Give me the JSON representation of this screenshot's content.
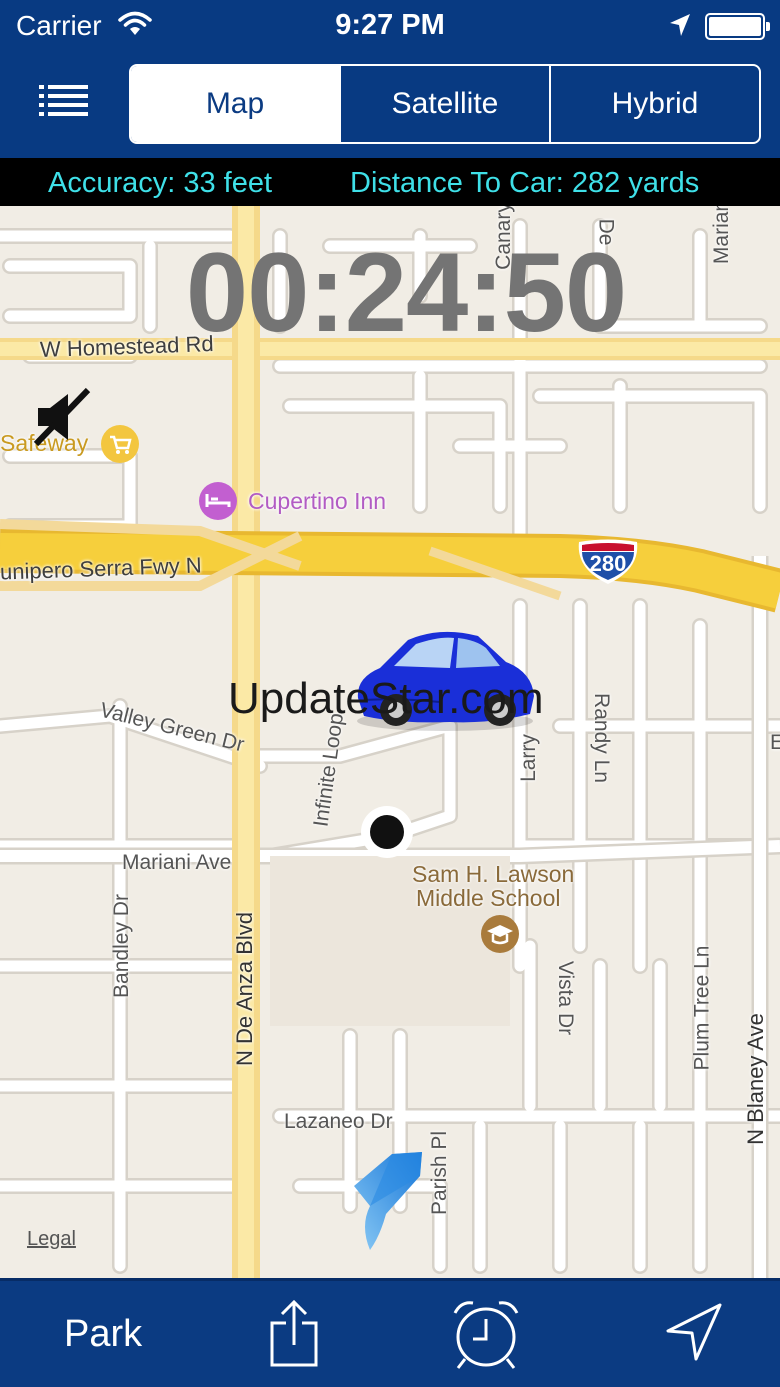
{
  "status_bar": {
    "carrier": "Carrier",
    "time": "9:27 PM"
  },
  "nav": {
    "segments": [
      "Map",
      "Satellite",
      "Hybrid"
    ],
    "selected_segment": "Map"
  },
  "info": {
    "accuracy": "Accuracy: 33 feet",
    "distance": "Distance To Car: 282 yards"
  },
  "map": {
    "timer": "00:24:50",
    "watermark": "UpdateStar.com",
    "streets": {
      "homestead": "W Homestead Rd",
      "freeway": "unipero Serra Fwy N",
      "valley_green": "Valley Green Dr",
      "mariani": "Mariani Ave",
      "bandley": "Bandley Dr",
      "de_anza": "N De Anza Blvd",
      "infinite_loop": "Infinite Loop",
      "larry": "Larry",
      "randy": "Randy Ln",
      "vista": "Vista Dr",
      "plum_tree": "Plum Tree Ln",
      "blaney": "N Blaney Ave",
      "lazaneo": "Lazaneo Dr",
      "parish": "Parish Pl",
      "canary": "Canary",
      "mariani_top": "Marian",
      "de_top": "De",
      "e_edge": "E"
    },
    "pois": {
      "safeway": "Safeway",
      "cupertino_inn": "Cupertino Inn",
      "school_line1": "Sam H. Lawson",
      "school_line2": "Middle School"
    },
    "highway_shield": "280",
    "legal": "Legal"
  },
  "tab_bar": {
    "park": "Park"
  },
  "colors": {
    "bar_blue": "#0b3b82",
    "info_text": "#3fe0e8",
    "highway": "#f6cf3c"
  },
  "icons": [
    "list-icon",
    "wifi-icon",
    "location-arrow-icon",
    "battery-icon",
    "mute-icon",
    "shopping-cart-icon",
    "hotel-icon",
    "school-icon",
    "car-icon",
    "user-location-icon",
    "heading-arrow-icon",
    "share-icon",
    "alarm-clock-icon",
    "navigation-arrow-icon"
  ]
}
